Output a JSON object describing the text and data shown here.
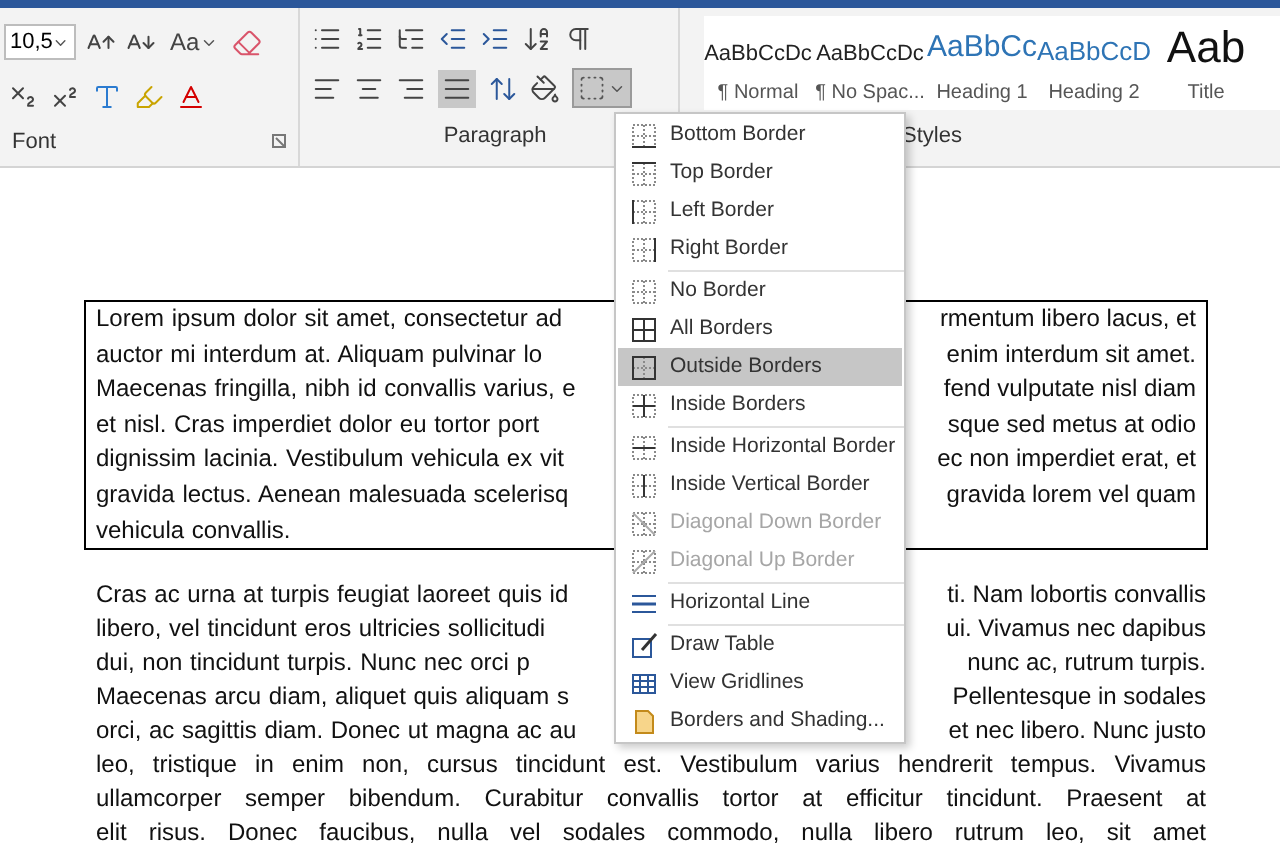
{
  "ribbon": {
    "font_size": "10,5",
    "change_case": "Aa",
    "groups": [
      {
        "label": "Font"
      },
      {
        "label": "Paragraph"
      },
      {
        "label": "Styles"
      }
    ],
    "styles": [
      {
        "preview": "AaBbCcDc",
        "name": "¶ Normal",
        "kind": "body"
      },
      {
        "preview": "AaBbCcDc",
        "name": "¶ No Spac...",
        "kind": "body"
      },
      {
        "preview": "AaBbCc",
        "name": "Heading 1",
        "kind": "heading1"
      },
      {
        "preview": "AaBbCcD",
        "name": "Heading 2",
        "kind": "heading2"
      },
      {
        "preview": "Aab",
        "name": "Title",
        "kind": "title"
      }
    ],
    "borders_button": {
      "selected": true
    }
  },
  "border_menu": [
    {
      "label": "Bottom Border",
      "disabled": false,
      "selected": false,
      "separator_after": false
    },
    {
      "label": "Top Border",
      "disabled": false,
      "selected": false,
      "separator_after": false
    },
    {
      "label": "Left Border",
      "disabled": false,
      "selected": false,
      "separator_after": false
    },
    {
      "label": "Right Border",
      "disabled": false,
      "selected": false,
      "separator_after": true
    },
    {
      "label": "No Border",
      "disabled": false,
      "selected": false,
      "separator_after": false
    },
    {
      "label": "All Borders",
      "disabled": false,
      "selected": false,
      "separator_after": false
    },
    {
      "label": "Outside Borders",
      "disabled": false,
      "selected": true,
      "separator_after": false
    },
    {
      "label": "Inside Borders",
      "disabled": false,
      "selected": false,
      "separator_after": true
    },
    {
      "label": "Inside Horizontal Border",
      "disabled": false,
      "selected": false,
      "separator_after": false
    },
    {
      "label": "Inside Vertical Border",
      "disabled": false,
      "selected": false,
      "separator_after": false
    },
    {
      "label": "Diagonal Down Border",
      "disabled": true,
      "selected": false,
      "separator_after": false
    },
    {
      "label": "Diagonal Up Border",
      "disabled": true,
      "selected": false,
      "separator_after": true
    },
    {
      "label": "Horizontal Line",
      "disabled": false,
      "selected": false,
      "separator_after": true
    },
    {
      "label": "Draw Table",
      "disabled": false,
      "selected": false,
      "separator_after": false
    },
    {
      "label": "View Gridlines",
      "disabled": false,
      "selected": false,
      "separator_after": false
    },
    {
      "label": "Borders and Shading...",
      "disabled": false,
      "selected": false,
      "separator_after": false
    }
  ],
  "document": [
    {
      "bordered": true,
      "lines": [
        {
          "left": "Lorem ipsum dolor sit amet, consectetur ad",
          "right": "rmentum libero lacus, et"
        },
        {
          "left": "auctor mi interdum at. Aliquam pulvinar lo",
          "right": "enim interdum sit amet."
        },
        {
          "left": "Maecenas fringilla, nibh id convallis varius, e",
          "right": "fend vulputate nisl diam"
        },
        {
          "left": "et nisl. Cras imperdiet dolor eu tortor port",
          "right": "sque sed metus at odio"
        },
        {
          "left": "dignissim lacinia. Vestibulum vehicula ex vit",
          "right": "ec non imperdiet erat, et"
        },
        {
          "left": "gravida lectus. Aenean malesuada scelerisq",
          "right": "gravida lorem vel quam"
        },
        {
          "left": "vehicula convallis."
        }
      ]
    },
    {
      "bordered": false,
      "lines": [
        {
          "left": "Cras ac urna at turpis feugiat laoreet quis id",
          "right": "ti. Nam lobortis convallis"
        },
        {
          "left": "libero, vel tincidunt eros ultricies sollicitudi",
          "right": "ui. Vivamus nec dapibus"
        },
        {
          "left": "dui, non tincidunt turpis. Nunc nec orci p",
          "right": "nunc ac, rutrum turpis."
        },
        {
          "left": "Maecenas arcu diam, aliquet quis aliquam s",
          "right": "Pellentesque in sodales"
        },
        {
          "left": "orci, ac sagittis diam. Donec ut magna ac au",
          "right": "et nec libero. Nunc justo"
        },
        {
          "full": "leo, tristique in enim non, cursus tincidunt est. Vestibulum varius hendrerit tempus. Vivamus"
        },
        {
          "full": "ullamcorper semper bibendum. Curabitur convallis tortor at efficitur tincidunt. Praesent at"
        },
        {
          "full": "elit risus. Donec faucibus, nulla vel sodales commodo, nulla libero rutrum leo, sit amet"
        }
      ]
    }
  ]
}
